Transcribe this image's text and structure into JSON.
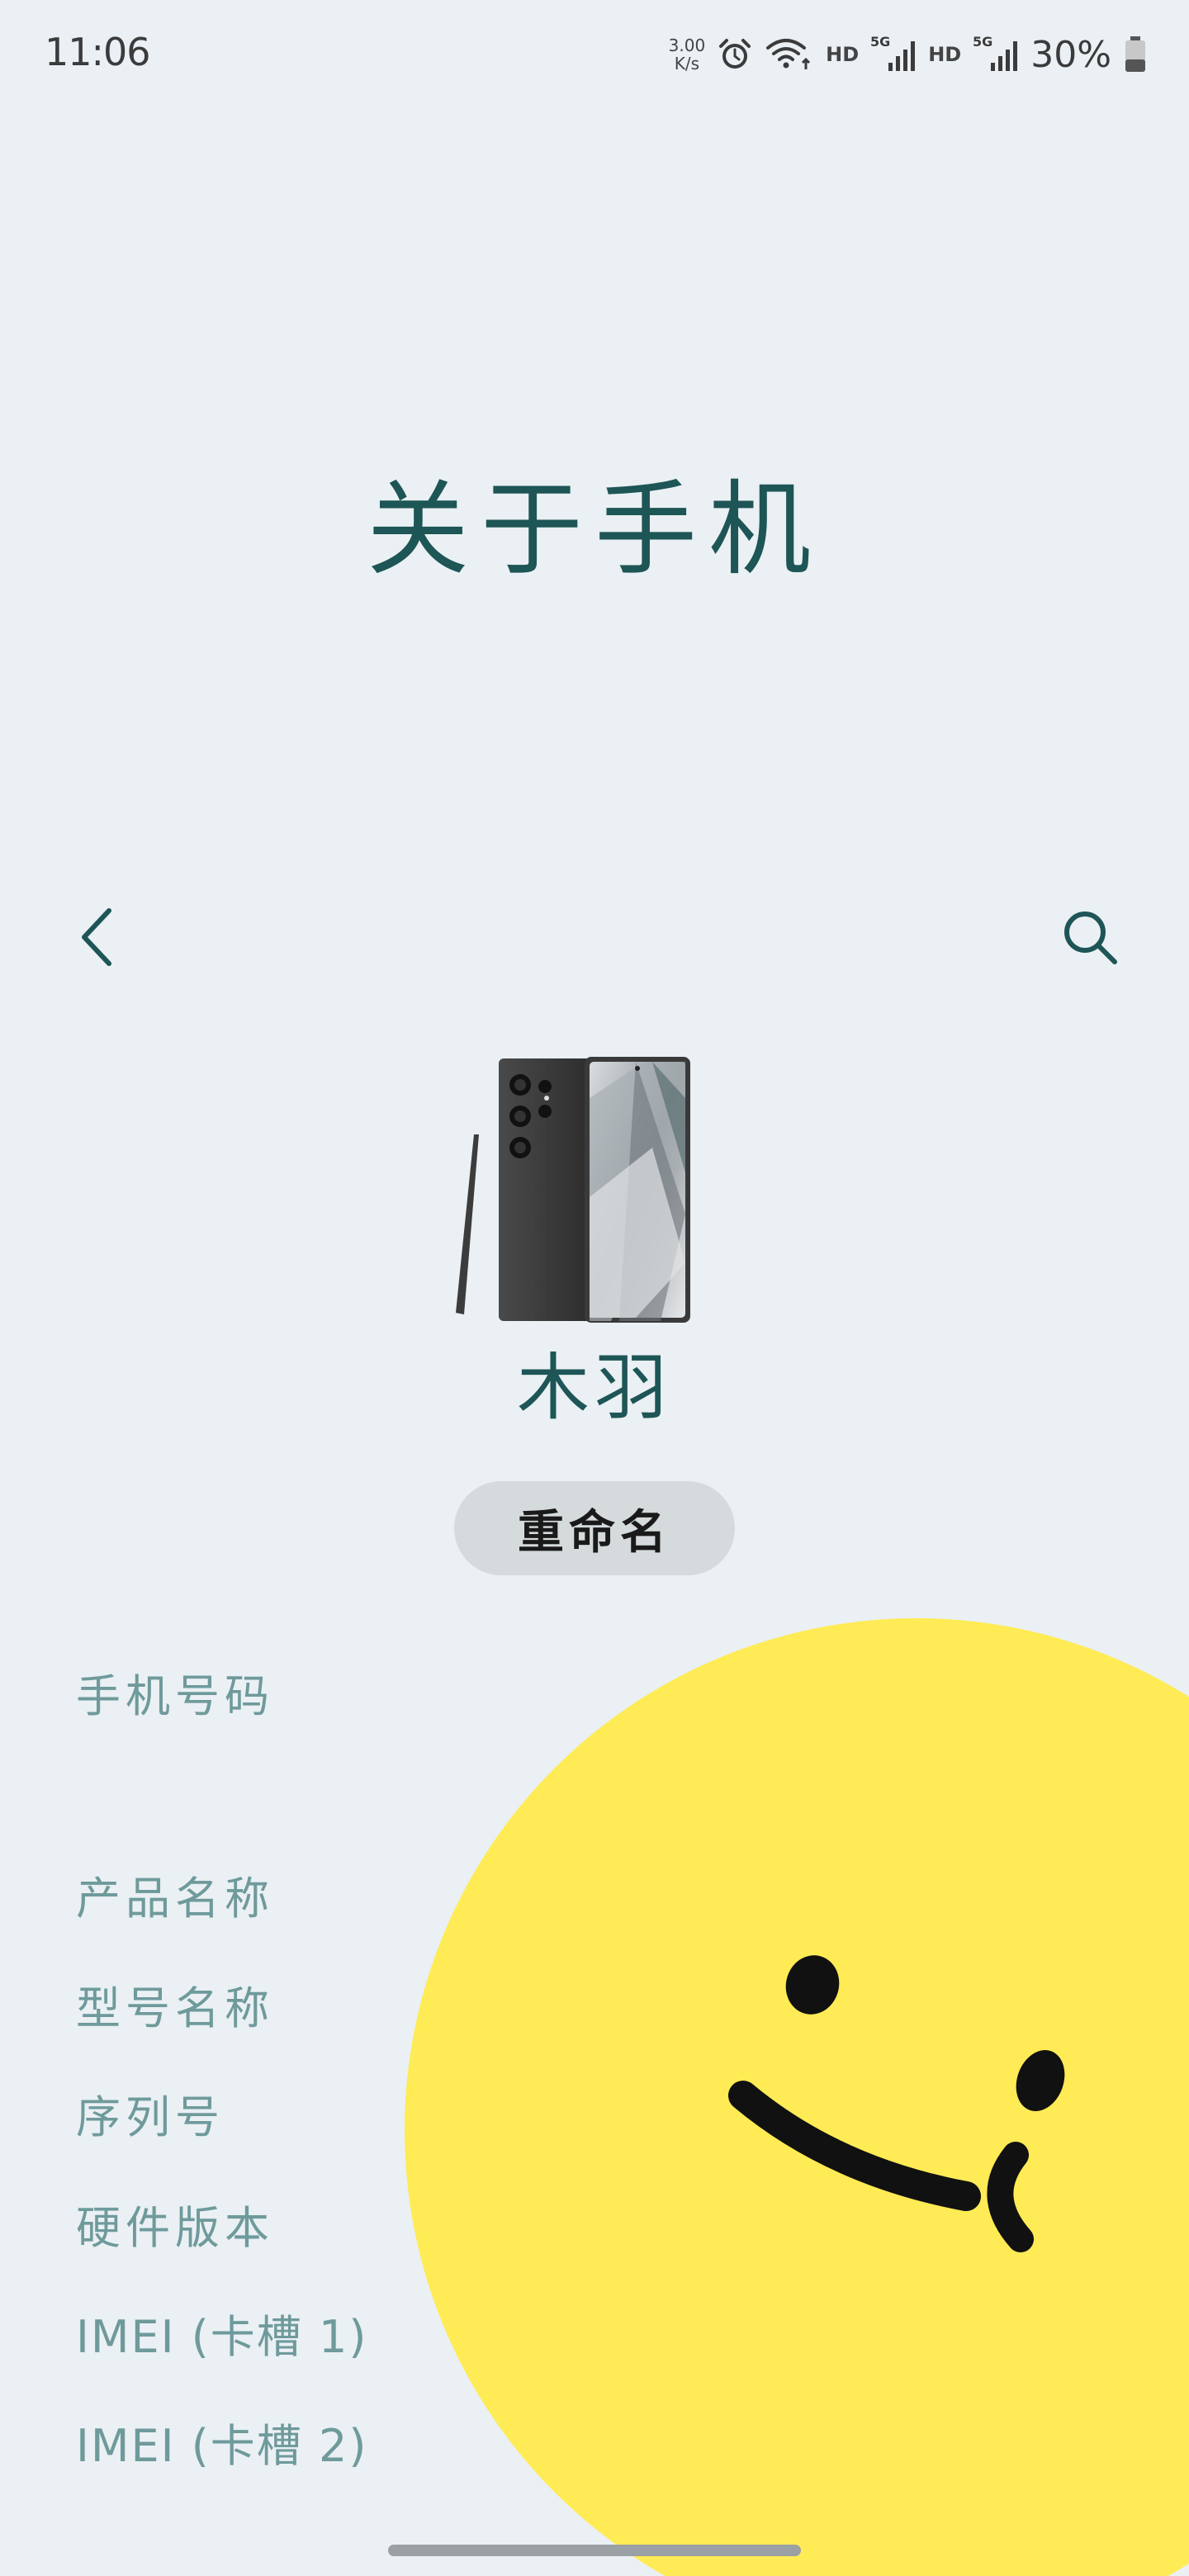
{
  "status_bar": {
    "time": "11:06",
    "net_speed_value": "3.00",
    "net_speed_unit": "K/s",
    "hd_1": "HD",
    "hd_2": "HD",
    "sim_1_type": "5G",
    "sim_2_type": "5G",
    "battery": "30%"
  },
  "header": {
    "title": "关于手机"
  },
  "toolbar": {
    "back_icon": "chevron-left-icon",
    "search_icon": "search-icon"
  },
  "device": {
    "name": "木羽",
    "rename_label": "重命名"
  },
  "info_list": {
    "items": [
      "手机号码",
      "产品名称",
      "型号名称",
      "序列号",
      "硬件版本",
      "IMEI (卡槽 1)",
      "IMEI (卡槽 2)"
    ]
  },
  "colors": {
    "background": "#eaf0f3",
    "title": "#1e5556",
    "muted_label": "#6f9a9c",
    "rename_bg": "#d5dbdd",
    "smiley_yellow": "#ffeb55"
  }
}
